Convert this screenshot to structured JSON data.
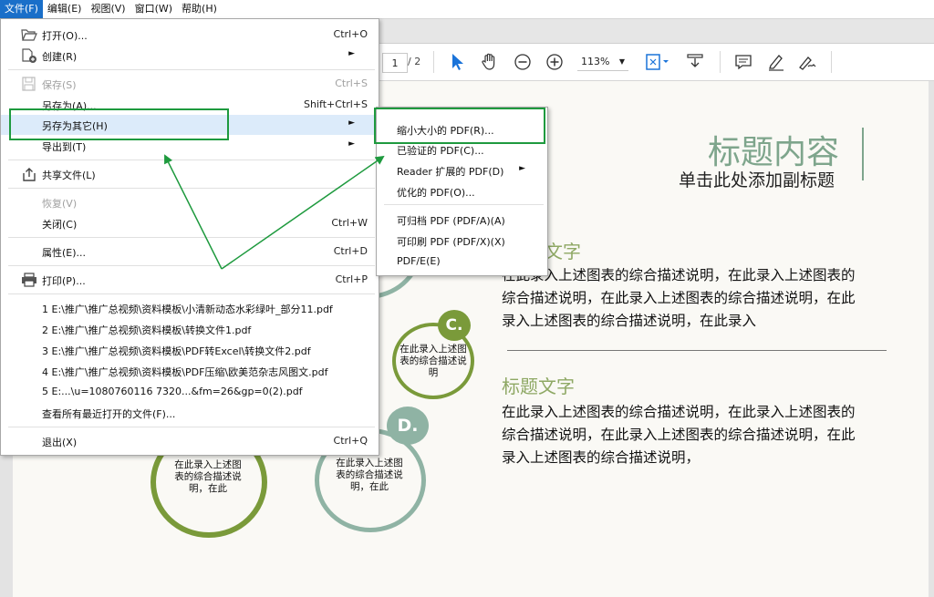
{
  "menubar": [
    {
      "label": "文件(F)",
      "active": true
    },
    {
      "label": "编辑(E)"
    },
    {
      "label": "视图(V)"
    },
    {
      "label": "窗口(W)"
    },
    {
      "label": "帮助(H)"
    }
  ],
  "toolbar": {
    "page_current": "1",
    "page_total": "/ 2",
    "zoom": "113%"
  },
  "file_menu": {
    "open": {
      "label": "打开(O)...",
      "shortcut": "Ctrl+O"
    },
    "create": {
      "label": "创建(R)"
    },
    "save": {
      "label": "保存(S)",
      "shortcut": "Ctrl+S"
    },
    "save_as": {
      "label": "另存为(A)...",
      "shortcut": "Shift+Ctrl+S"
    },
    "save_as_other": {
      "label": "另存为其它(H)"
    },
    "export": {
      "label": "导出到(T)"
    },
    "share": {
      "label": "共享文件(L)"
    },
    "revert": {
      "label": "恢复(V)"
    },
    "close": {
      "label": "关闭(C)",
      "shortcut": "Ctrl+W"
    },
    "properties": {
      "label": "属性(E)...",
      "shortcut": "Ctrl+D"
    },
    "print": {
      "label": "打印(P)...",
      "shortcut": "Ctrl+P"
    },
    "recent": [
      "1 E:\\推广\\推广总视频\\资料模板\\小清新动态水彩绿叶_部分11.pdf",
      "2 E:\\推广\\推广总视频\\资料模板\\转换文件1.pdf",
      "3 E:\\推广\\推广总视频\\资料模板\\PDF转Excel\\转换文件2.pdf",
      "4 E:\\推广\\推广总视频\\资料模板\\PDF压缩\\欧美范杂志风图文.pdf",
      "5 E:...\\u=1080760116 7320...&fm=26&gp=0(2).pdf"
    ],
    "view_all_recent": "查看所有最近打开的文件(F)...",
    "exit": {
      "label": "退出(X)",
      "shortcut": "Ctrl+Q"
    }
  },
  "submenu": [
    {
      "label": "缩小大小的 PDF(R)...",
      "separator_after": false
    },
    {
      "label": "已验证的 PDF(C)..."
    },
    {
      "label": "Reader 扩展的 PDF(D)",
      "arrow": true
    },
    {
      "label": "优化的 PDF(O)..."
    },
    {
      "label": "可归档 PDF (PDF/A)(A)"
    },
    {
      "label": "可印刷 PDF (PDF/X)(X)"
    },
    {
      "label": "PDF/E(E)"
    }
  ],
  "document": {
    "title": "标题内容",
    "subtitle": "单击此处添加副标题",
    "section1_title": "文字",
    "section1_text": "在此录入上述图表的综合描述说明，在此录入上述图表的综合描述说明，在此录入上述图表的综合描述说明，在此录入上述图表的综合描述说明，在此录入",
    "section2_title": "标题文字",
    "section2_text": "在此录入上述图表的综合描述说明，在此录入上述图表的综合描述说明，在此录入上述图表的综合描述说明，在此录入上述图表的综合描述说明，",
    "circle_c_badge": "C.",
    "circle_c_text": "在此录入上述图表的综合描述说明",
    "circle_d_badge": "D.",
    "circle_d_text": "在此录入上述图表的综合描述说明，在此",
    "circle_left_text": "在此录入上述图表的综合描述说明，在此"
  },
  "colors": {
    "accent_green": "#1e9a3e",
    "title_teal": "#7ea58c",
    "olive": "#7a9a3a",
    "menubar_active": "#1a6fc9"
  }
}
